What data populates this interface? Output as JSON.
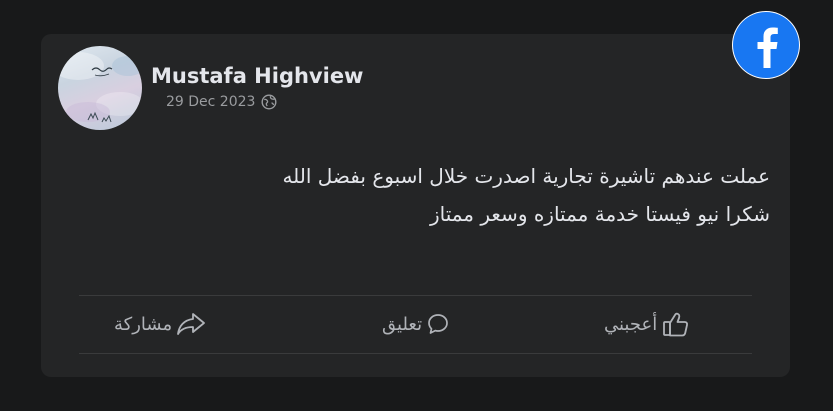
{
  "post": {
    "author_name": "Mustafa Highview",
    "date": "29 Dec 2023",
    "text_lines": [
      "عملت عندهم تاشيرة تجارية اصدرت خلال اسبوع بفضل الله",
      "شكرا نيو فيستا خدمة ممتازه وسعر ممتاز"
    ]
  },
  "actions": {
    "like_label": "أعجبني",
    "comment_label": "تعليق",
    "share_label": "مشاركة"
  },
  "icons": {
    "brand": "facebook-logo-icon",
    "privacy": "globe-icon",
    "like": "thumbs-up-icon",
    "comment": "comment-bubble-icon",
    "share": "share-arrow-icon"
  },
  "colors": {
    "background": "#18191a",
    "card": "#242526",
    "facebook_blue": "#1877f2",
    "text_primary": "#e4e6eb",
    "text_secondary": "#b0b3b8"
  }
}
